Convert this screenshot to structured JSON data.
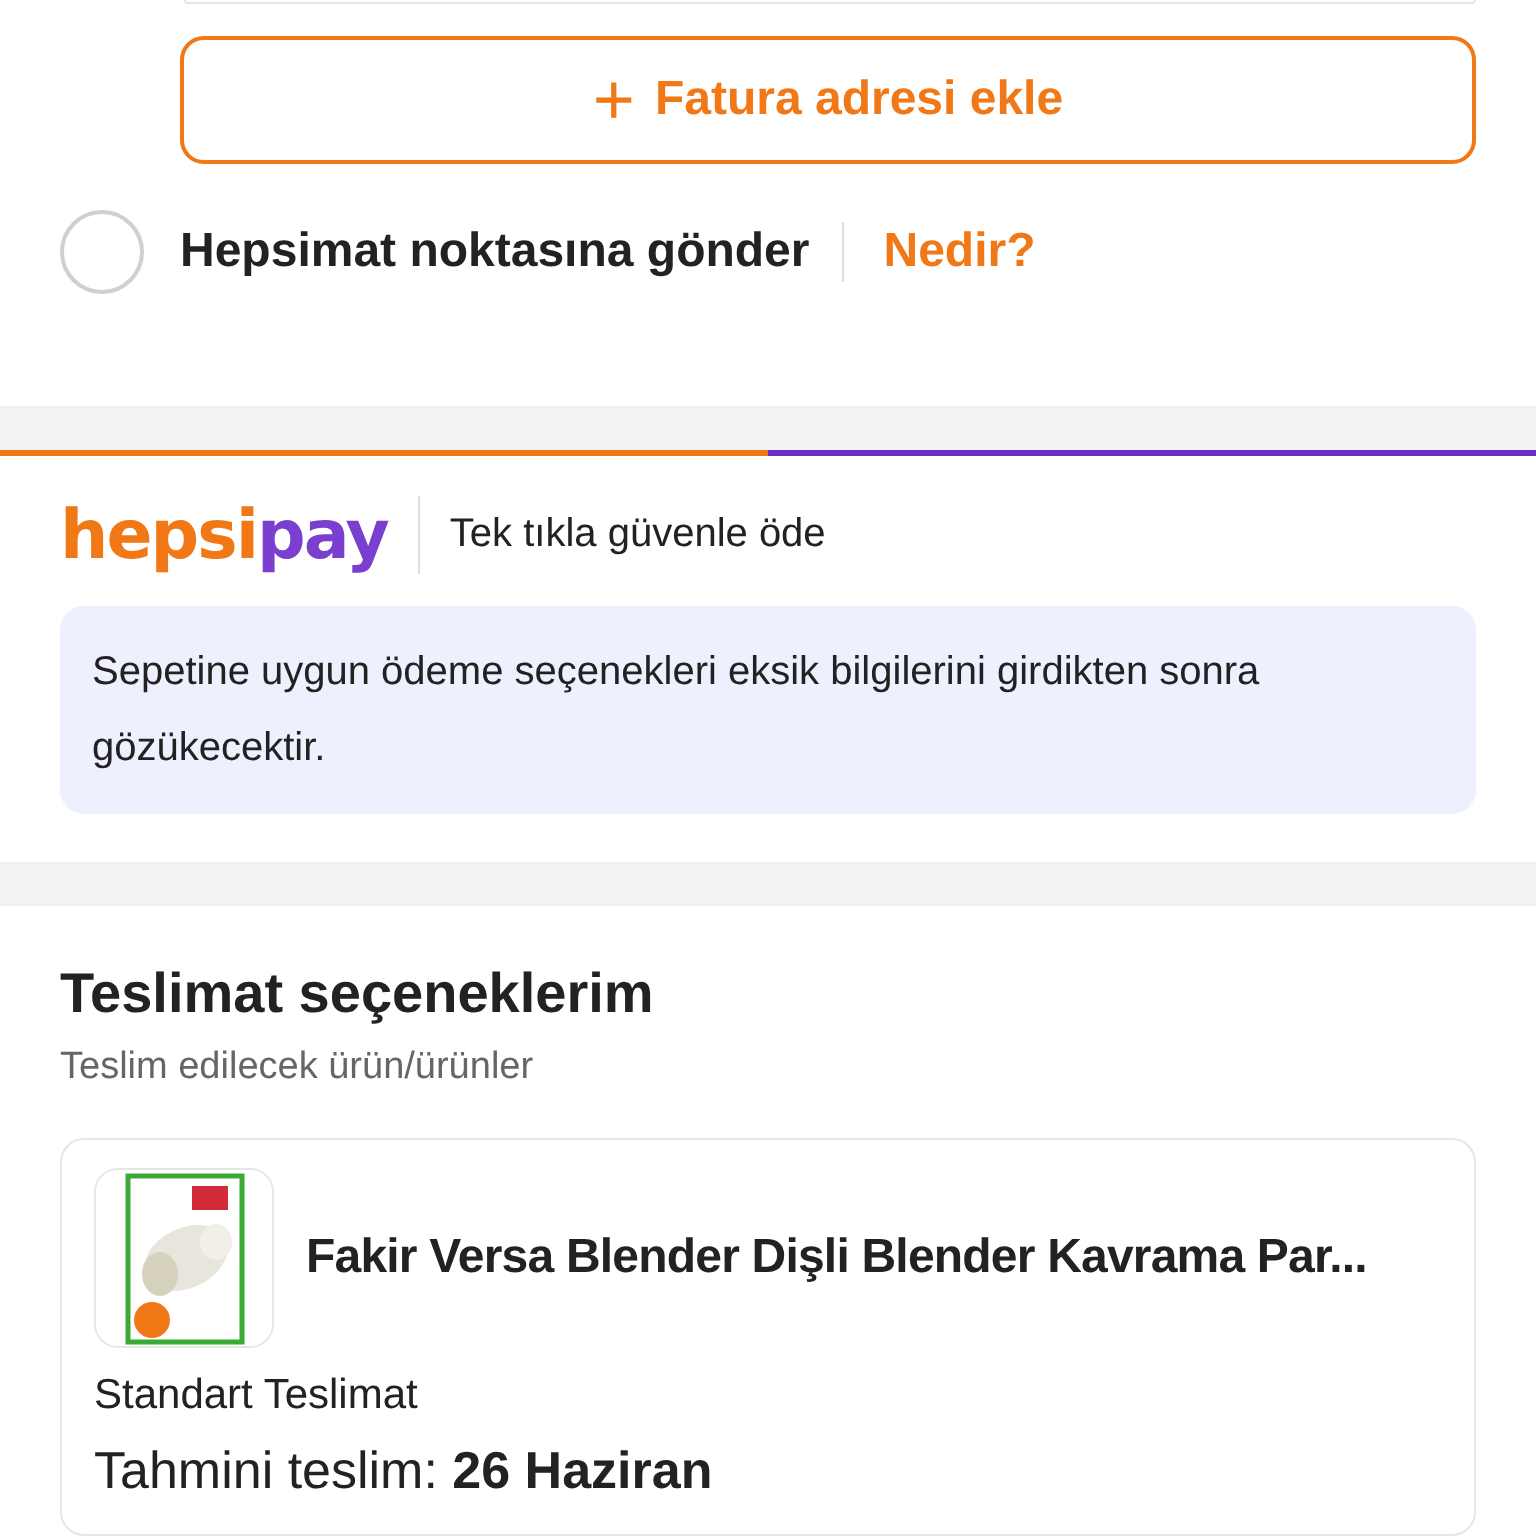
{
  "billing": {
    "add_button": {
      "icon": "+",
      "label": "Fatura adresi ekle"
    }
  },
  "pickup": {
    "label": "Hepsimat noktasına gönder",
    "selected": false,
    "link": "Nedir?"
  },
  "hepsipay": {
    "logo_left": "hepsi",
    "logo_right": "pay",
    "tagline": "Tek tıkla güvenle öde",
    "notice": "Sepetine uygun ödeme seçenekleri eksik bilgilerini girdikten sonra gözükecektir."
  },
  "delivery": {
    "title": "Teslimat seçeneklerim",
    "subtitle": "Teslim edilecek ürün/ürünler",
    "items": [
      {
        "kind": "picture",
        "name": "Fakir Versa Blender Dişli Blender Kavrama Par...",
        "method": "Standart Teslimat",
        "estimate": "Tahmini teslim: **26 Haziran**"
      }
    ]
  }
}
